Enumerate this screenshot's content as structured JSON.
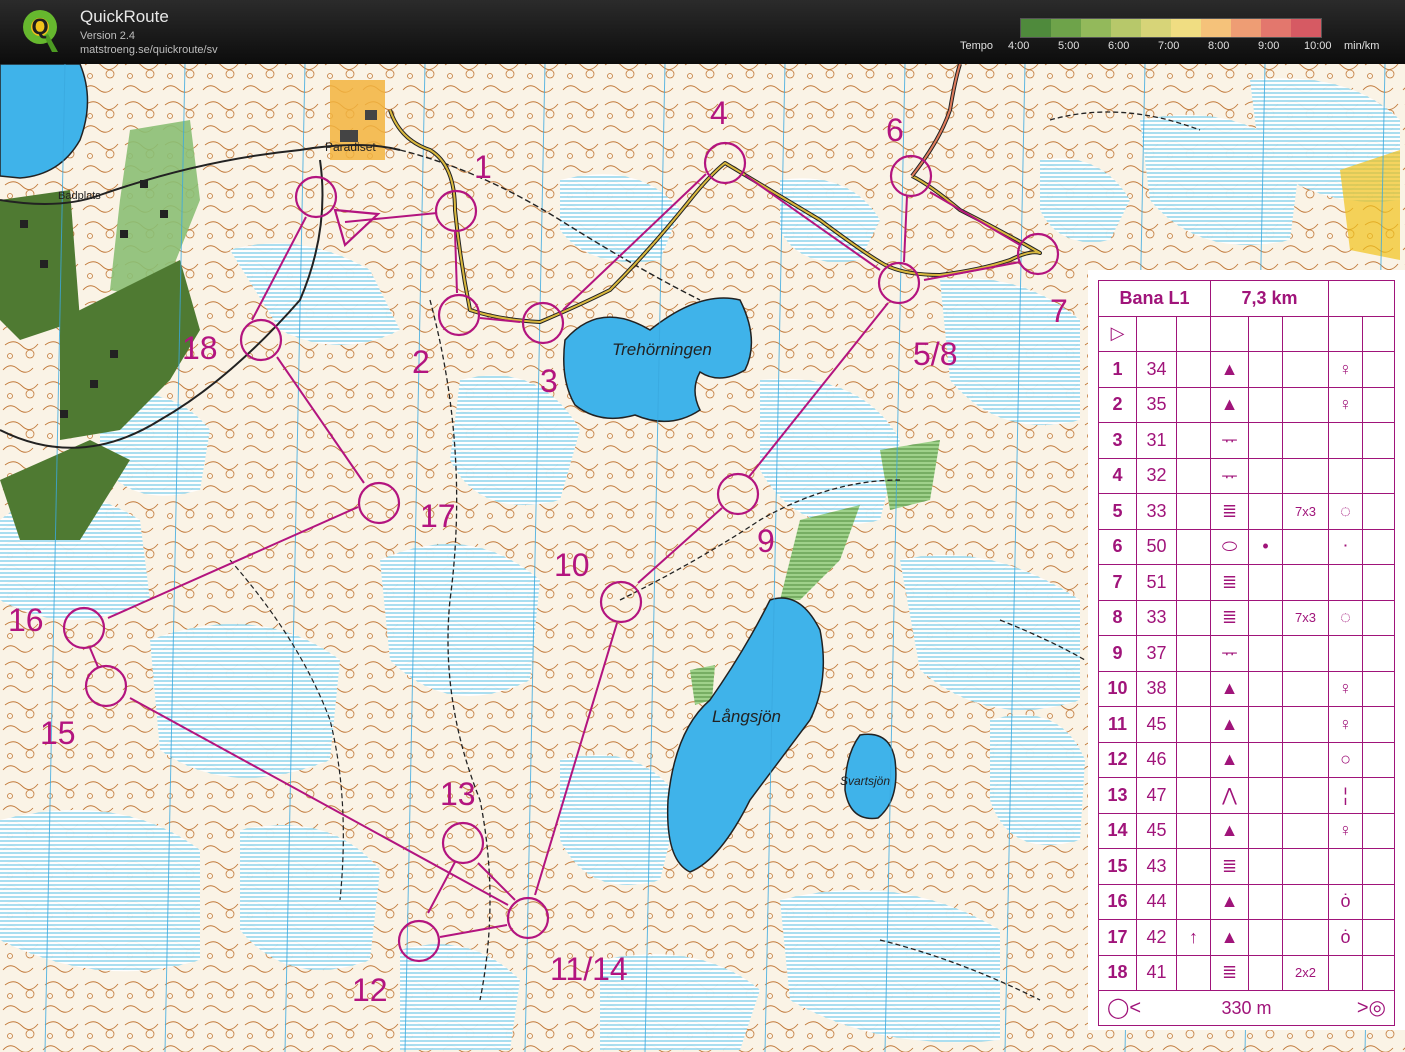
{
  "app": {
    "name": "QuickRoute",
    "version": "Version 2.4",
    "url": "matstroeng.se/quickroute/sv"
  },
  "tempo": {
    "label": "Tempo",
    "ticks": [
      "4:00",
      "5:00",
      "6:00",
      "7:00",
      "8:00",
      "9:00",
      "10:00"
    ],
    "unit": "min/km",
    "colors": [
      "#4f8a3c",
      "#6ea34a",
      "#93b95b",
      "#b7c86a",
      "#d7d478",
      "#f0dd82",
      "#f5c27a",
      "#ee9d74",
      "#e3776d",
      "#d65a63"
    ]
  },
  "map": {
    "place_labels": [
      "Badplats",
      "Paradiset",
      "Trehörningen",
      "Långsjön",
      "Svartsjön"
    ],
    "control_labels": [
      "1",
      "2",
      "3",
      "4",
      "5/8",
      "6",
      "7",
      "9",
      "10",
      "11/14",
      "12",
      "13",
      "15",
      "16",
      "17",
      "18"
    ],
    "colors": {
      "course": "#b3147f",
      "water": "#3fb3ea",
      "marsh": "#5bc4dc",
      "forest_dark": "#4f7a32",
      "contour": "#b2621f",
      "route": "#c79b2e"
    }
  },
  "course_table": {
    "title": "Bana L1",
    "length": "7,3 km",
    "start_symbol": "▷",
    "rows": [
      {
        "no": "1",
        "code": "34",
        "extra": "",
        "feature": "▲",
        "detail": "",
        "dim": "",
        "pos": "♀"
      },
      {
        "no": "2",
        "code": "35",
        "extra": "",
        "feature": "▲",
        "detail": "",
        "dim": "",
        "pos": "♀"
      },
      {
        "no": "3",
        "code": "31",
        "extra": "",
        "feature": "ᅲ",
        "detail": "",
        "dim": "",
        "pos": ""
      },
      {
        "no": "4",
        "code": "32",
        "extra": "",
        "feature": "ᅲ",
        "detail": "",
        "dim": "",
        "pos": ""
      },
      {
        "no": "5",
        "code": "33",
        "extra": "",
        "feature": "≣",
        "detail": "",
        "dim": "7x3",
        "pos": "◌"
      },
      {
        "no": "6",
        "code": "50",
        "extra": "",
        "feature": "⬭",
        "detail": "•",
        "dim": "",
        "pos": "⋅"
      },
      {
        "no": "7",
        "code": "51",
        "extra": "",
        "feature": "≣",
        "detail": "",
        "dim": "",
        "pos": ""
      },
      {
        "no": "8",
        "code": "33",
        "extra": "",
        "feature": "≣",
        "detail": "",
        "dim": "7x3",
        "pos": "◌"
      },
      {
        "no": "9",
        "code": "37",
        "extra": "",
        "feature": "ᅲ",
        "detail": "",
        "dim": "",
        "pos": ""
      },
      {
        "no": "10",
        "code": "38",
        "extra": "",
        "feature": "▲",
        "detail": "",
        "dim": "",
        "pos": "♀"
      },
      {
        "no": "11",
        "code": "45",
        "extra": "",
        "feature": "▲",
        "detail": "",
        "dim": "",
        "pos": "♀"
      },
      {
        "no": "12",
        "code": "46",
        "extra": "",
        "feature": "▲",
        "detail": "",
        "dim": "",
        "pos": "○"
      },
      {
        "no": "13",
        "code": "47",
        "extra": "",
        "feature": "⋀",
        "detail": "",
        "dim": "",
        "pos": "¦"
      },
      {
        "no": "14",
        "code": "45",
        "extra": "",
        "feature": "▲",
        "detail": "",
        "dim": "",
        "pos": "♀"
      },
      {
        "no": "15",
        "code": "43",
        "extra": "",
        "feature": "≣",
        "detail": "",
        "dim": "",
        "pos": ""
      },
      {
        "no": "16",
        "code": "44",
        "extra": "",
        "feature": "▲",
        "detail": "",
        "dim": "",
        "pos": "ȯ"
      },
      {
        "no": "17",
        "code": "42",
        "extra": "↑",
        "feature": "▲",
        "detail": "",
        "dim": "",
        "pos": "ȯ"
      },
      {
        "no": "18",
        "code": "41",
        "extra": "",
        "feature": "≣",
        "detail": "",
        "dim": "2x2",
        "pos": ""
      }
    ],
    "finish_distance": "330 m"
  }
}
